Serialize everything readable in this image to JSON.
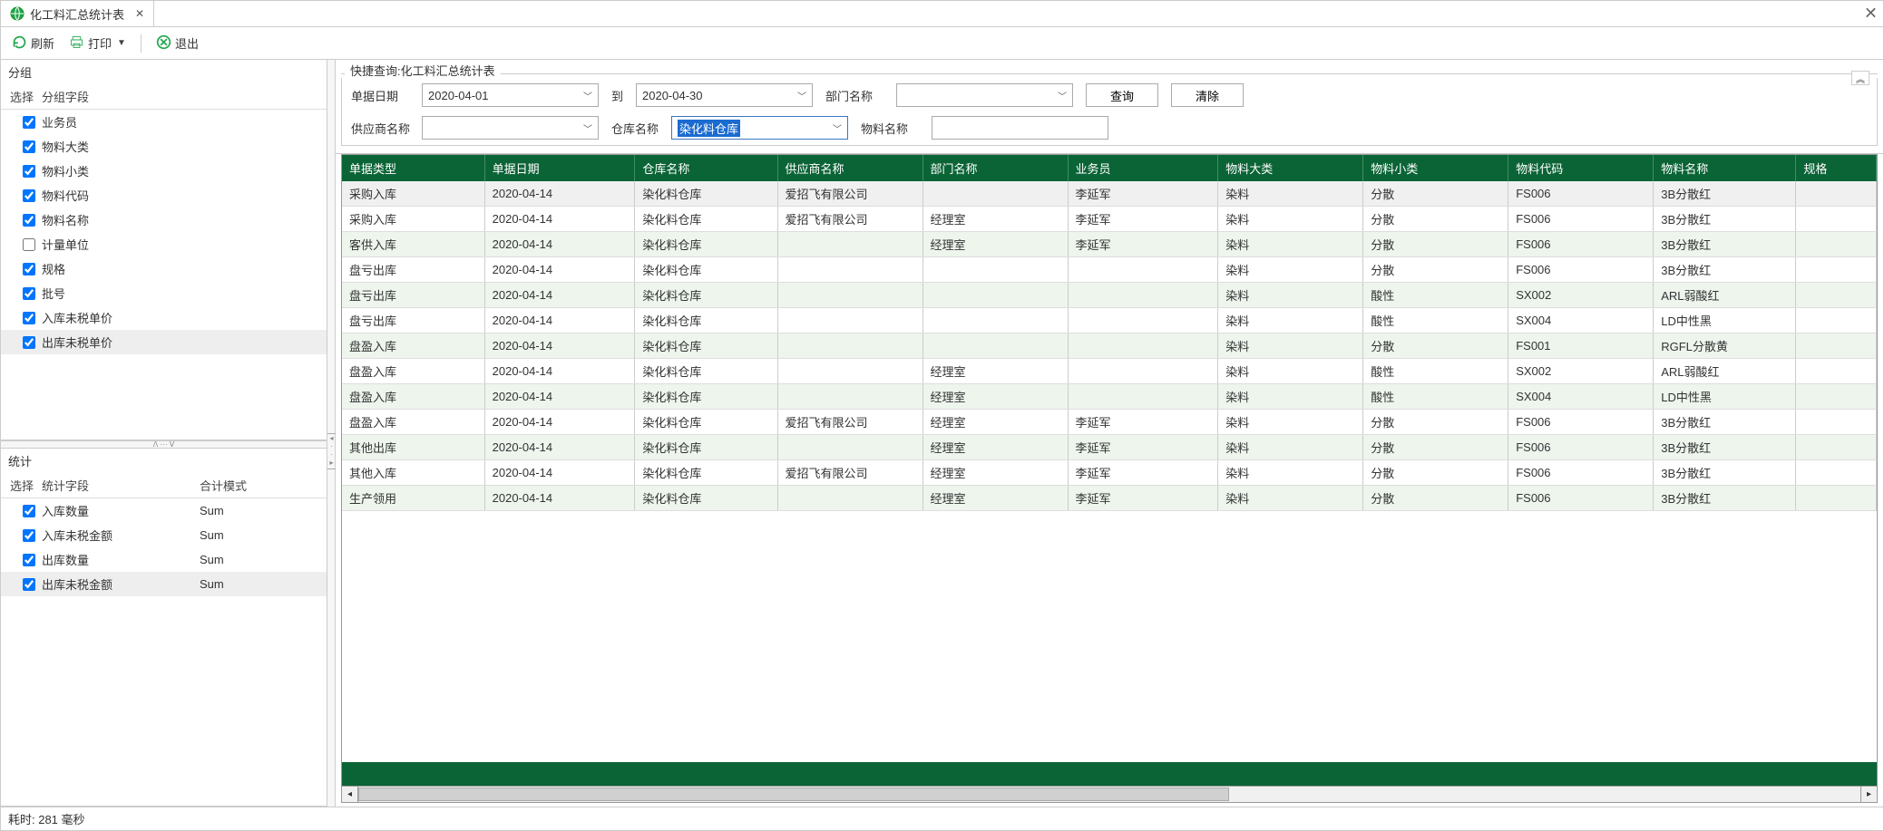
{
  "tab": {
    "title": "化工料汇总统计表"
  },
  "toolbar": {
    "refresh": "刷新",
    "print": "打印",
    "exit": "退出"
  },
  "leftPanel": {
    "groupTitle": "分组",
    "selectHeader": "选择",
    "groupFieldHeader": "分组字段",
    "groups": [
      {
        "label": "业务员",
        "checked": true
      },
      {
        "label": "物料大类",
        "checked": true
      },
      {
        "label": "物料小类",
        "checked": true
      },
      {
        "label": "物料代码",
        "checked": true
      },
      {
        "label": "物料名称",
        "checked": true
      },
      {
        "label": "计量单位",
        "checked": false
      },
      {
        "label": "规格",
        "checked": true
      },
      {
        "label": "批号",
        "checked": true
      },
      {
        "label": "入库未税单价",
        "checked": true
      },
      {
        "label": "出库未税单价",
        "checked": true
      }
    ],
    "statTitle": "统计",
    "statFieldHeader": "统计字段",
    "statModeHeader": "合计模式",
    "stats": [
      {
        "label": "入库数量",
        "mode": "Sum",
        "checked": true
      },
      {
        "label": "入库未税金额",
        "mode": "Sum",
        "checked": true
      },
      {
        "label": "出库数量",
        "mode": "Sum",
        "checked": true
      },
      {
        "label": "出库未税金额",
        "mode": "Sum",
        "checked": true
      }
    ]
  },
  "filter": {
    "legend": "快捷查询:化工料汇总统计表",
    "dateLabel": "单据日期",
    "dateFrom": "2020-04-01",
    "toLabel": "到",
    "dateTo": "2020-04-30",
    "deptLabel": "部门名称",
    "deptValue": "",
    "supplierLabel": "供应商名称",
    "supplierValue": "",
    "warehouseLabel": "仓库名称",
    "warehouseValue": "染化料仓库",
    "materialLabel": "物料名称",
    "materialValue": "",
    "queryBtn": "查询",
    "clearBtn": "清除"
  },
  "table": {
    "headers": [
      "单据类型",
      "单据日期",
      "仓库名称",
      "供应商名称",
      "部门名称",
      "业务员",
      "物料大类",
      "物料小类",
      "物料代码",
      "物料名称",
      "规格"
    ],
    "rows": [
      [
        "采购入库",
        "2020-04-14",
        "染化料仓库",
        "爱招飞有限公司",
        "",
        "李延军",
        "染料",
        "分散",
        "FS006",
        "3B分散红",
        ""
      ],
      [
        "采购入库",
        "2020-04-14",
        "染化料仓库",
        "爱招飞有限公司",
        "经理室",
        "李延军",
        "染料",
        "分散",
        "FS006",
        "3B分散红",
        ""
      ],
      [
        "客供入库",
        "2020-04-14",
        "染化料仓库",
        "",
        "经理室",
        "李延军",
        "染料",
        "分散",
        "FS006",
        "3B分散红",
        ""
      ],
      [
        "盘亏出库",
        "2020-04-14",
        "染化料仓库",
        "",
        "",
        "",
        "染料",
        "分散",
        "FS006",
        "3B分散红",
        ""
      ],
      [
        "盘亏出库",
        "2020-04-14",
        "染化料仓库",
        "",
        "",
        "",
        "染料",
        "酸性",
        "SX002",
        "ARL弱酸红",
        ""
      ],
      [
        "盘亏出库",
        "2020-04-14",
        "染化料仓库",
        "",
        "",
        "",
        "染料",
        "酸性",
        "SX004",
        "LD中性黑",
        ""
      ],
      [
        "盘盈入库",
        "2020-04-14",
        "染化料仓库",
        "",
        "",
        "",
        "染料",
        "分散",
        "FS001",
        "RGFL分散黄",
        ""
      ],
      [
        "盘盈入库",
        "2020-04-14",
        "染化料仓库",
        "",
        "经理室",
        "",
        "染料",
        "酸性",
        "SX002",
        "ARL弱酸红",
        ""
      ],
      [
        "盘盈入库",
        "2020-04-14",
        "染化料仓库",
        "",
        "经理室",
        "",
        "染料",
        "酸性",
        "SX004",
        "LD中性黑",
        ""
      ],
      [
        "盘盈入库",
        "2020-04-14",
        "染化料仓库",
        "爱招飞有限公司",
        "经理室",
        "李延军",
        "染料",
        "分散",
        "FS006",
        "3B分散红",
        ""
      ],
      [
        "其他出库",
        "2020-04-14",
        "染化料仓库",
        "",
        "经理室",
        "李延军",
        "染料",
        "分散",
        "FS006",
        "3B分散红",
        ""
      ],
      [
        "其他入库",
        "2020-04-14",
        "染化料仓库",
        "爱招飞有限公司",
        "经理室",
        "李延军",
        "染料",
        "分散",
        "FS006",
        "3B分散红",
        ""
      ],
      [
        "生产领用",
        "2020-04-14",
        "染化料仓库",
        "",
        "经理室",
        "李延军",
        "染料",
        "分散",
        "FS006",
        "3B分散红",
        ""
      ]
    ]
  },
  "status": {
    "elapsed": "耗时: 281 毫秒"
  }
}
